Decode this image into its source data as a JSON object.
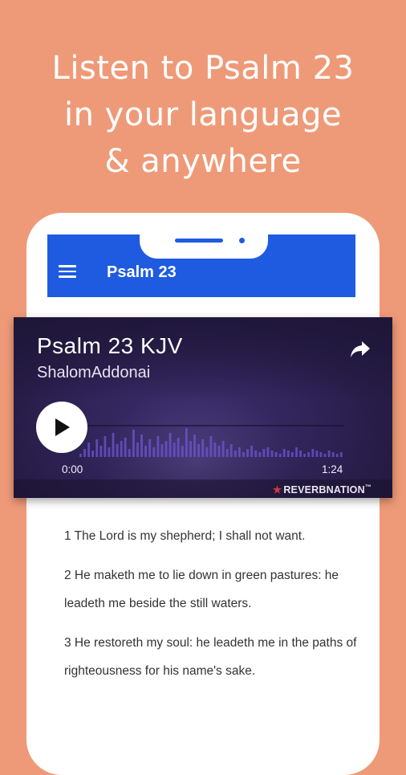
{
  "colors": {
    "background": "#EE9A78",
    "primary": "#1E5BE0",
    "player_accent": "#6B57D6"
  },
  "promo": {
    "line1": "Listen to Psalm 23",
    "line2": "in your language",
    "line3": "& anywhere"
  },
  "app": {
    "title": "Psalm 23",
    "menu_icon": "hamburger-menu-icon"
  },
  "player": {
    "title": "Psalm 23 KJV",
    "artist": "ShalomAddonai",
    "time_current": "0:00",
    "time_total": "1:24",
    "progress": 0,
    "brand": "REVERBNATION",
    "brand_mark": "™",
    "share_icon": "share-icon",
    "play_icon": "play-icon"
  },
  "verses": [
    "1 The Lord is my shepherd; I shall not want.",
    "2 He maketh me to lie down in green pastures: he leadeth me beside the still waters.",
    "3 He restoreth my soul: he leadeth me in the paths of righteousness for his name's sake."
  ]
}
